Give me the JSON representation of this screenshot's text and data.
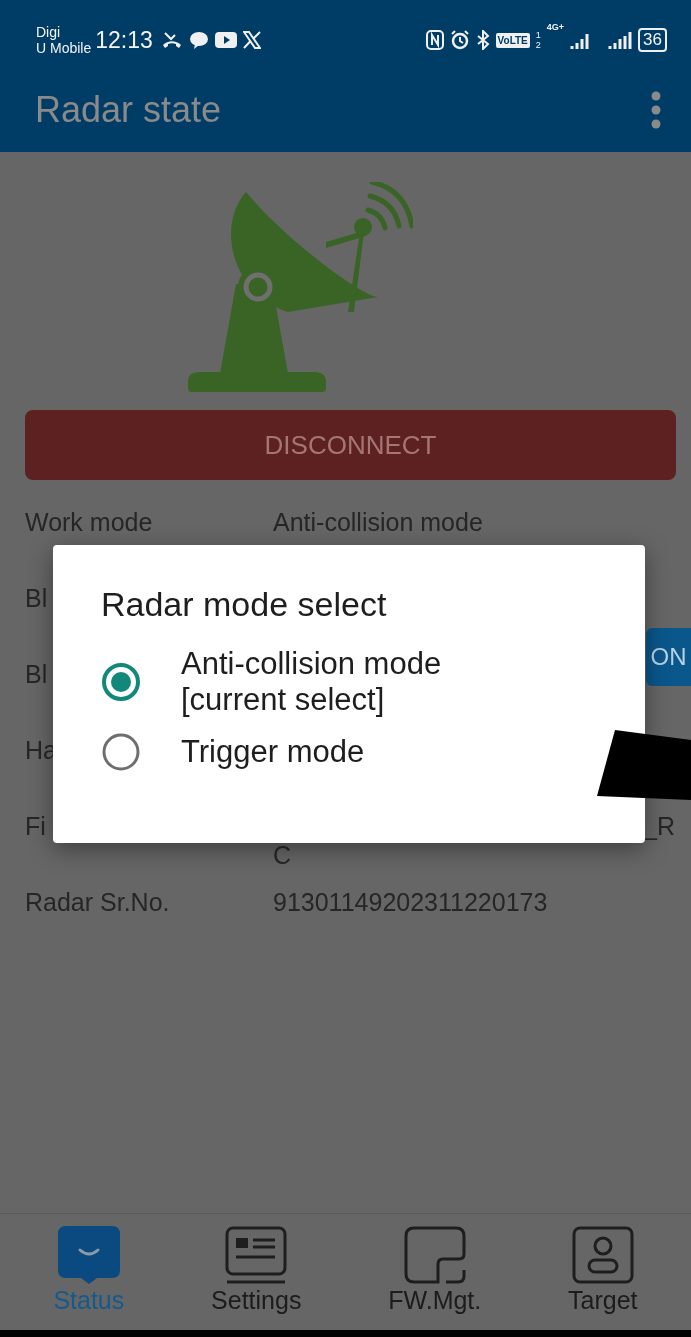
{
  "status_bar": {
    "carrier_lines": [
      "Digi",
      "U Mobile"
    ],
    "time": "12:13",
    "volte": "VoLTE",
    "sim_numbers": [
      "1",
      "2"
    ],
    "network": "4G+",
    "battery": "36"
  },
  "app_bar": {
    "title": "Radar state"
  },
  "disconnect_button": {
    "label": "DISCONNECT"
  },
  "info_rows": [
    {
      "label": "Work mode",
      "value": "Anti-collision mode"
    },
    {
      "label": "Bl"
    },
    {
      "label": "Bl",
      "button": "ON"
    },
    {
      "label": "Ha"
    },
    {
      "label": "Fi",
      "value_end": "_R",
      "value_continued": "C"
    },
    {
      "label": "Radar Sr.No.",
      "value": "91301149202311220173"
    }
  ],
  "dialog": {
    "title": "Radar mode select",
    "options": [
      {
        "lines": [
          "Anti-collision mode",
          "[current select]"
        ],
        "selected": true
      },
      {
        "lines": [
          "Trigger mode"
        ],
        "selected": false
      }
    ]
  },
  "bottom_nav": [
    {
      "kind": "status",
      "label": "Status",
      "selected": true
    },
    {
      "kind": "settings",
      "label": "Settings",
      "selected": false
    },
    {
      "kind": "firmware",
      "label": "FW.Mgt.",
      "selected": false
    },
    {
      "kind": "target",
      "label": "Target",
      "selected": false
    }
  ]
}
